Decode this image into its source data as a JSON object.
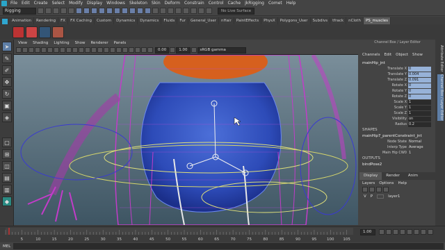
{
  "menubar": {
    "items": [
      "File",
      "Edit",
      "Create",
      "Select",
      "Modify",
      "Display",
      "Windows",
      "Skeleton",
      "Skin",
      "Deform",
      "Constrain",
      "Control",
      "Cache",
      "jkRigging",
      "Comet",
      "Help"
    ]
  },
  "statusline": {
    "mode": "Rigging",
    "live_surface": "No Live Surface"
  },
  "shelf": {
    "tabs": [
      "Animation",
      "Rendering",
      "FX",
      "FX Caching",
      "Custom",
      "Dynamics",
      "Dynamics",
      "Fluids",
      "Fur",
      "General_User",
      "nHair",
      "PaintEffects",
      "PhysX",
      "Polygons_User",
      "Subdivs",
      "tfrack",
      "nCloth",
      "PS_muscles"
    ],
    "active_tab": "PS_muscles"
  },
  "panel": {
    "menu": [
      "View",
      "Shading",
      "Lighting",
      "Show",
      "Renderer",
      "Panels"
    ],
    "field_a": "0.00",
    "field_b": "1.00",
    "colorspace": "sRGB gamma"
  },
  "channel_box": {
    "menu": [
      "Channels",
      "Edit",
      "Object",
      "Show"
    ],
    "header_title": "Channel Box / Layer Editor",
    "node": "mainHip_jnt",
    "attributes": [
      {
        "label": "Translate X",
        "value": "0",
        "keyed": true
      },
      {
        "label": "Translate Y",
        "value": "0.004",
        "keyed": true
      },
      {
        "label": "Translate Z",
        "value": "0.091",
        "keyed": true
      },
      {
        "label": "Rotate X",
        "value": "0",
        "keyed": true
      },
      {
        "label": "Rotate Y",
        "value": "0",
        "keyed": true
      },
      {
        "label": "Rotate Z",
        "value": "0",
        "keyed": true
      },
      {
        "label": "Scale X",
        "value": "1",
        "keyed": false
      },
      {
        "label": "Scale Y",
        "value": "1",
        "keyed": false
      },
      {
        "label": "Scale Z",
        "value": "1",
        "keyed": false
      },
      {
        "label": "Visibility",
        "value": "on",
        "keyed": false
      },
      {
        "label": "Radius",
        "value": "0.2",
        "keyed": false
      }
    ],
    "shapes_label": "SHAPES",
    "constraint_node": "mainHip7_parentConstraint_jnt",
    "constraint_attrs": [
      {
        "label": "Node State",
        "value": "Normal"
      },
      {
        "label": "Interp Type",
        "value": "Average"
      },
      {
        "label": "Main Hip CW0",
        "value": "1"
      }
    ],
    "outputs_label": "OUTPUTS",
    "output_node": "bindPose2"
  },
  "layer_editor": {
    "tabs": [
      "Display",
      "Render",
      "Anim"
    ],
    "menu": [
      "Layers",
      "Options",
      "Help"
    ],
    "layer": {
      "v": "V",
      "p": "P",
      "name": "layer1"
    }
  },
  "right_tabs": [
    "Attribute Editor",
    "Channel Box / Layer Editor"
  ],
  "timeline": {
    "ticks": [
      "5",
      "10",
      "15",
      "20",
      "25",
      "30",
      "35",
      "40",
      "45",
      "50",
      "55",
      "60",
      "65",
      "70",
      "75",
      "80",
      "85",
      "90",
      "95",
      "100",
      "105"
    ],
    "current_frame": "1.00"
  },
  "command_line": {
    "label": "MEL"
  }
}
